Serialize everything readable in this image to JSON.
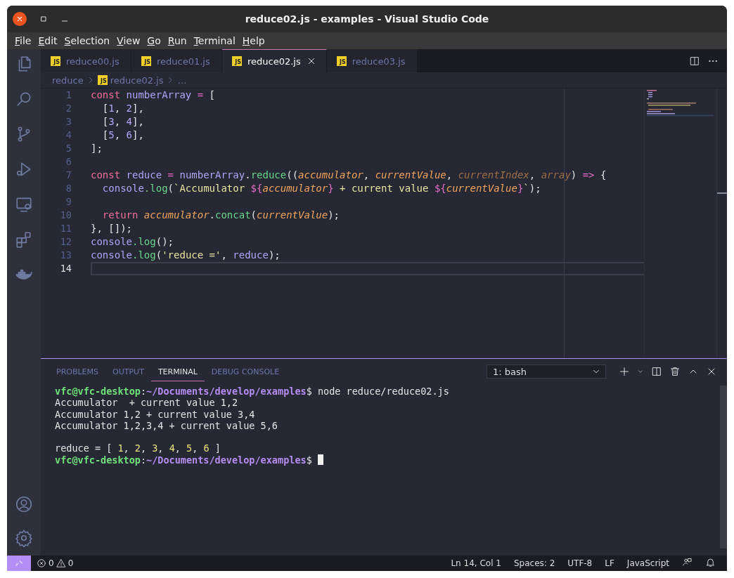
{
  "window": {
    "title": "reduce02.js - examples - Visual Studio Code"
  },
  "menu": [
    "File",
    "Edit",
    "Selection",
    "View",
    "Go",
    "Run",
    "Terminal",
    "Help"
  ],
  "tabs": [
    {
      "label": "reduce00.js",
      "icon_text": "JS",
      "selected": false
    },
    {
      "label": "reduce01.js",
      "icon_text": "JS",
      "selected": false
    },
    {
      "label": "reduce02.js",
      "icon_text": "JS",
      "selected": true
    },
    {
      "label": "reduce03.js",
      "icon_text": "JS",
      "selected": false
    }
  ],
  "breadcrumb": {
    "folder": "reduce",
    "file": "reduce02.js",
    "icon_text": "JS",
    "more": "…"
  },
  "code": [
    {
      "number": "1",
      "current": false,
      "tokens": [
        {
          "t": "const ",
          "kind": "keyword"
        },
        {
          "t": "numberArray ",
          "kind": "variable"
        },
        {
          "t": "=",
          "kind": "operator"
        },
        {
          "t": " [",
          "kind": "punct"
        }
      ]
    },
    {
      "number": "2",
      "current": false,
      "tokens": [
        {
          "t": "  [",
          "kind": "punct"
        },
        {
          "t": "1",
          "kind": "number"
        },
        {
          "t": ", ",
          "kind": "punct"
        },
        {
          "t": "2",
          "kind": "number"
        },
        {
          "t": "],",
          "kind": "punct"
        }
      ]
    },
    {
      "number": "3",
      "current": false,
      "tokens": [
        {
          "t": "  [",
          "kind": "punct"
        },
        {
          "t": "3",
          "kind": "number"
        },
        {
          "t": ", ",
          "kind": "punct"
        },
        {
          "t": "4",
          "kind": "number"
        },
        {
          "t": "],",
          "kind": "punct"
        }
      ]
    },
    {
      "number": "4",
      "current": false,
      "tokens": [
        {
          "t": "  [",
          "kind": "punct"
        },
        {
          "t": "5",
          "kind": "number"
        },
        {
          "t": ", ",
          "kind": "punct"
        },
        {
          "t": "6",
          "kind": "number"
        },
        {
          "t": "],",
          "kind": "punct"
        }
      ]
    },
    {
      "number": "5",
      "current": false,
      "tokens": [
        {
          "t": "];",
          "kind": "punct"
        }
      ]
    },
    {
      "number": "6",
      "current": false
    },
    {
      "number": "7",
      "current": false,
      "tokens": [
        {
          "t": "const ",
          "kind": "keyword"
        },
        {
          "t": "reduce ",
          "kind": "variable"
        },
        {
          "t": "=",
          "kind": "operator"
        },
        {
          "t": " numberArray",
          "kind": "variable"
        },
        {
          "t": ".",
          "kind": "punct"
        },
        {
          "t": "reduce",
          "kind": "function"
        },
        {
          "t": "((",
          "kind": "punct"
        },
        {
          "t": "accumulator",
          "kind": "param"
        },
        {
          "t": ", ",
          "kind": "punct"
        },
        {
          "t": "currentValue",
          "kind": "param"
        },
        {
          "t": ", ",
          "kind": "punct"
        },
        {
          "t": "currentIndex",
          "kind": "unused"
        },
        {
          "t": ", ",
          "kind": "punct"
        },
        {
          "t": "array",
          "kind": "unused"
        },
        {
          "t": ") ",
          "kind": "punct"
        },
        {
          "t": "=>",
          "kind": "operator"
        },
        {
          "t": " {",
          "kind": "punct"
        }
      ]
    },
    {
      "number": "8",
      "current": false,
      "tokens": [
        {
          "t": "  console",
          "kind": "variable"
        },
        {
          "t": ".log",
          "kind": "function"
        },
        {
          "t": "(",
          "kind": "punct"
        },
        {
          "t": "`Accumulator ",
          "kind": "string"
        },
        {
          "t": "${",
          "kind": "operator"
        },
        {
          "t": "accumulator",
          "kind": "param"
        },
        {
          "t": "}",
          "kind": "operator"
        },
        {
          "t": " + current value ",
          "kind": "string"
        },
        {
          "t": "${",
          "kind": "operator"
        },
        {
          "t": "currentValue",
          "kind": "param"
        },
        {
          "t": "}",
          "kind": "operator"
        },
        {
          "t": "`",
          "kind": "string"
        },
        {
          "t": ");",
          "kind": "punct"
        }
      ]
    },
    {
      "number": "9",
      "current": false
    },
    {
      "number": "10",
      "current": false,
      "tokens": [
        {
          "t": "  return ",
          "kind": "keyword"
        },
        {
          "t": "accumulator",
          "kind": "param"
        },
        {
          "t": ".",
          "kind": "punct"
        },
        {
          "t": "concat",
          "kind": "function"
        },
        {
          "t": "(",
          "kind": "punct"
        },
        {
          "t": "currentValue",
          "kind": "param"
        },
        {
          "t": ");",
          "kind": "punct"
        }
      ]
    },
    {
      "number": "11",
      "current": false,
      "tokens": [
        {
          "t": "}, []);",
          "kind": "punct"
        }
      ]
    },
    {
      "number": "12",
      "current": false,
      "tokens": [
        {
          "t": "console",
          "kind": "variable"
        },
        {
          "t": ".log",
          "kind": "function"
        },
        {
          "t": "();",
          "kind": "punct"
        }
      ]
    },
    {
      "number": "13",
      "current": false,
      "tokens": [
        {
          "t": "console",
          "kind": "variable"
        },
        {
          "t": ".log",
          "kind": "function"
        },
        {
          "t": "(",
          "kind": "punct"
        },
        {
          "t": "'reduce ='",
          "kind": "string"
        },
        {
          "t": ", ",
          "kind": "punct"
        },
        {
          "t": "reduce",
          "kind": "variable"
        },
        {
          "t": ");",
          "kind": "punct"
        }
      ]
    },
    {
      "number": "14",
      "current": true
    }
  ],
  "panel": {
    "tabs": [
      {
        "label": "PROBLEMS",
        "selected": false
      },
      {
        "label": "OUTPUT",
        "selected": false
      },
      {
        "label": "TERMINAL",
        "selected": true
      },
      {
        "label": "DEBUG CONSOLE",
        "selected": false
      }
    ],
    "terminal_select": "1: bash",
    "terminal": [
      {
        "cursor": false,
        "segments": [
          {
            "t": "vfc@vfc-desktop",
            "kind": "user"
          },
          {
            "t": ":",
            "kind": "plain"
          },
          {
            "t": "~/Documents/develop/examples",
            "kind": "path"
          },
          {
            "t": "$ node reduce/reduce02.js",
            "kind": "plain"
          }
        ]
      },
      {
        "cursor": false,
        "segments": [
          {
            "t": "Accumulator  + current value 1,2",
            "kind": "plain"
          }
        ]
      },
      {
        "cursor": false,
        "segments": [
          {
            "t": "Accumulator 1,2 + current value 3,4",
            "kind": "plain"
          }
        ]
      },
      {
        "cursor": false,
        "segments": [
          {
            "t": "Accumulator 1,2,3,4 + current value 5,6",
            "kind": "plain"
          }
        ]
      },
      {
        "cursor": false
      },
      {
        "cursor": false,
        "segments": [
          {
            "t": "reduce = [ ",
            "kind": "plain"
          },
          {
            "t": "1",
            "kind": "number"
          },
          {
            "t": ", ",
            "kind": "plain"
          },
          {
            "t": "2",
            "kind": "number"
          },
          {
            "t": ", ",
            "kind": "plain"
          },
          {
            "t": "3",
            "kind": "number"
          },
          {
            "t": ", ",
            "kind": "plain"
          },
          {
            "t": "4",
            "kind": "number"
          },
          {
            "t": ", ",
            "kind": "plain"
          },
          {
            "t": "5",
            "kind": "number"
          },
          {
            "t": ", ",
            "kind": "plain"
          },
          {
            "t": "6",
            "kind": "number"
          },
          {
            "t": " ]",
            "kind": "plain"
          }
        ]
      },
      {
        "cursor": true,
        "segments": [
          {
            "t": "vfc@vfc-desktop",
            "kind": "user"
          },
          {
            "t": ":",
            "kind": "plain"
          },
          {
            "t": "~/Documents/develop/examples",
            "kind": "path"
          },
          {
            "t": "$ ",
            "kind": "plain"
          }
        ]
      }
    ]
  },
  "status_bar": {
    "errors": "0",
    "warnings": "0",
    "items": [
      "Ln 14, Col 1",
      "Spaces: 2",
      "UTF-8",
      "LF",
      "JavaScript"
    ]
  }
}
